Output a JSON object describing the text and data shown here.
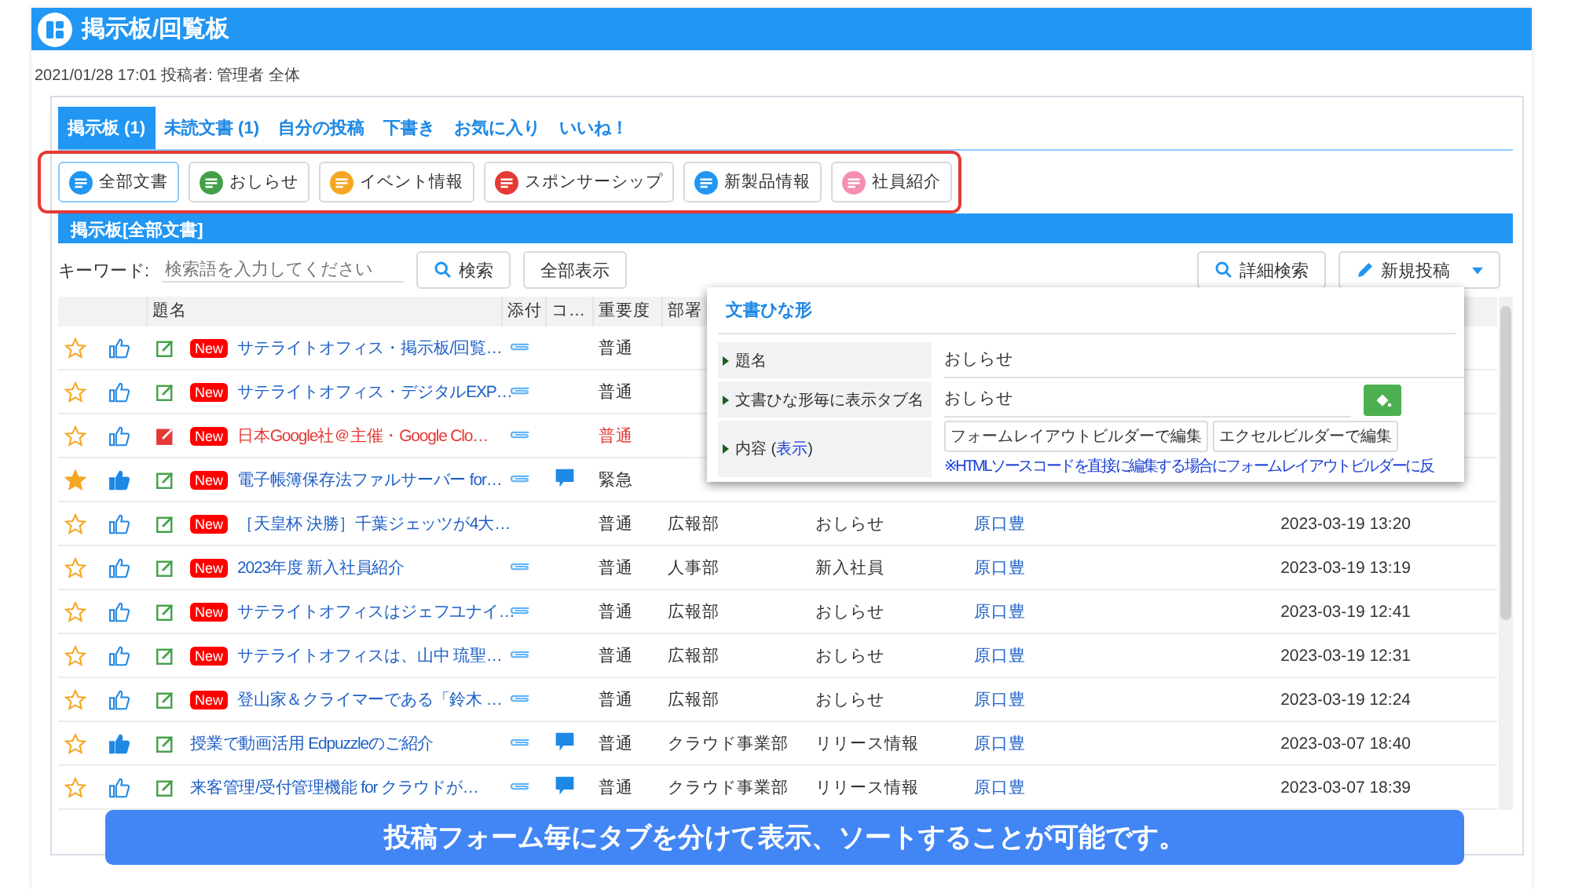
{
  "header": {
    "title": "掲示板/回覧板"
  },
  "meta": "2021/01/28 17:01 投稿者: 管理者 全体",
  "tabs": [
    {
      "label": "掲示板 (1)",
      "selected": true
    },
    {
      "label": "未読文書 (1)",
      "selected": false
    },
    {
      "label": "自分の投稿",
      "selected": false
    },
    {
      "label": "下書き",
      "selected": false
    },
    {
      "label": "お気に入り",
      "selected": false
    },
    {
      "label": "いいね！",
      "selected": false
    }
  ],
  "categories": [
    {
      "label": "全部文書",
      "color": "#2196f3",
      "selected": true
    },
    {
      "label": "おしらせ",
      "color": "#43a047",
      "selected": false
    },
    {
      "label": "イベント情報",
      "color": "#f5a623",
      "selected": false
    },
    {
      "label": "スポンサーシップ",
      "color": "#e53935",
      "selected": false
    },
    {
      "label": "新製品情報",
      "color": "#2196f3",
      "selected": false
    },
    {
      "label": "社員紹介",
      "color": "#f48fb1",
      "selected": false
    }
  ],
  "section_title": "掲示板[全部文書]",
  "search": {
    "label": "キーワード:",
    "placeholder": "検索語を入力してください",
    "search_button": "検索",
    "show_all_button": "全部表示",
    "advanced_button": "詳細検索",
    "new_post_button": "新規投稿"
  },
  "table": {
    "columns": [
      "題名",
      "添付",
      "コ…",
      "重要度",
      "部署"
    ],
    "rows": [
      {
        "starred": false,
        "liked": false,
        "highlighted": false,
        "badge": "New",
        "title": "サテライトオフィス・掲示板/回覧…",
        "attachment": true,
        "comment": false,
        "importance": "普通"
      },
      {
        "starred": false,
        "liked": false,
        "highlighted": false,
        "badge": "New",
        "title": "サテライトオフィス・デジタルEXP…",
        "attachment": true,
        "comment": false,
        "importance": "普通"
      },
      {
        "starred": false,
        "liked": false,
        "highlighted": true,
        "badge": "New",
        "title": "日本Google社＠主催・Google Clo…",
        "attachment": true,
        "comment": false,
        "importance": "普通"
      },
      {
        "starred": true,
        "liked": true,
        "highlighted": false,
        "badge": "New",
        "title": "電子帳簿保存法ファルサーバー for…",
        "attachment": true,
        "comment": true,
        "importance": "緊急"
      },
      {
        "starred": false,
        "liked": false,
        "highlighted": false,
        "badge": "New",
        "title": "［天皇杯 決勝］千葉ジェッツが4大…",
        "attachment": false,
        "comment": false,
        "importance": "普通",
        "department": "広報部",
        "category": "おしらせ",
        "author": "原口豊",
        "date": "2023-03-19 13:20"
      },
      {
        "starred": false,
        "liked": false,
        "highlighted": false,
        "badge": "New",
        "title": "2023年度 新入社員紹介",
        "attachment": true,
        "comment": false,
        "importance": "普通",
        "department": "人事部",
        "category": "新入社員",
        "author": "原口豊",
        "date": "2023-03-19 13:19"
      },
      {
        "starred": false,
        "liked": false,
        "highlighted": false,
        "badge": "New",
        "title": "サテライトオフィスはジェフユナイ…",
        "attachment": true,
        "comment": false,
        "importance": "普通",
        "department": "広報部",
        "category": "おしらせ",
        "author": "原口豊",
        "date": "2023-03-19 12:41"
      },
      {
        "starred": false,
        "liked": false,
        "highlighted": false,
        "badge": "New",
        "title": "サテライトオフィスは、山中 琉聖…",
        "attachment": true,
        "comment": false,
        "importance": "普通",
        "department": "広報部",
        "category": "おしらせ",
        "author": "原口豊",
        "date": "2023-03-19 12:31"
      },
      {
        "starred": false,
        "liked": false,
        "highlighted": false,
        "badge": "New",
        "title": "登山家＆クライマーである「鈴木 …",
        "attachment": true,
        "comment": false,
        "importance": "普通",
        "department": "広報部",
        "category": "おしらせ",
        "author": "原口豊",
        "date": "2023-03-19 12:24"
      },
      {
        "starred": false,
        "liked": true,
        "highlighted": false,
        "title": "授業で動画活用 Edpuzzleのご紹介",
        "attachment": true,
        "comment": true,
        "importance": "普通",
        "department": "クラウド事業部",
        "category": "リリース情報",
        "author": "原口豊",
        "date": "2023-03-07 18:40"
      },
      {
        "starred": false,
        "liked": false,
        "highlighted": false,
        "title": "来客管理/受付管理機能 for クラウドが…",
        "attachment": true,
        "comment": true,
        "importance": "普通",
        "department": "クラウド事業部",
        "category": "リリース情報",
        "author": "原口豊",
        "date": "2023-03-07 18:39"
      }
    ]
  },
  "dialog": {
    "title": "文書ひな形",
    "fields": [
      {
        "label": "題名",
        "value": "おしらせ"
      },
      {
        "label": "文書ひな形毎に表示タブ名",
        "value": "おしらせ"
      }
    ],
    "content_label": "内容 (",
    "content_link": "表示",
    "content_label_end": ")",
    "buttons": [
      "フォームレイアウトビルダーで編集",
      "エクセルビルダーで編集"
    ],
    "note": "※HTMLソースコードを直接に編集する場合にフォームレイアウトビルダーに反"
  },
  "caption": "投稿フォーム毎にタブを分けて表示、ソートすることが可能です。"
}
